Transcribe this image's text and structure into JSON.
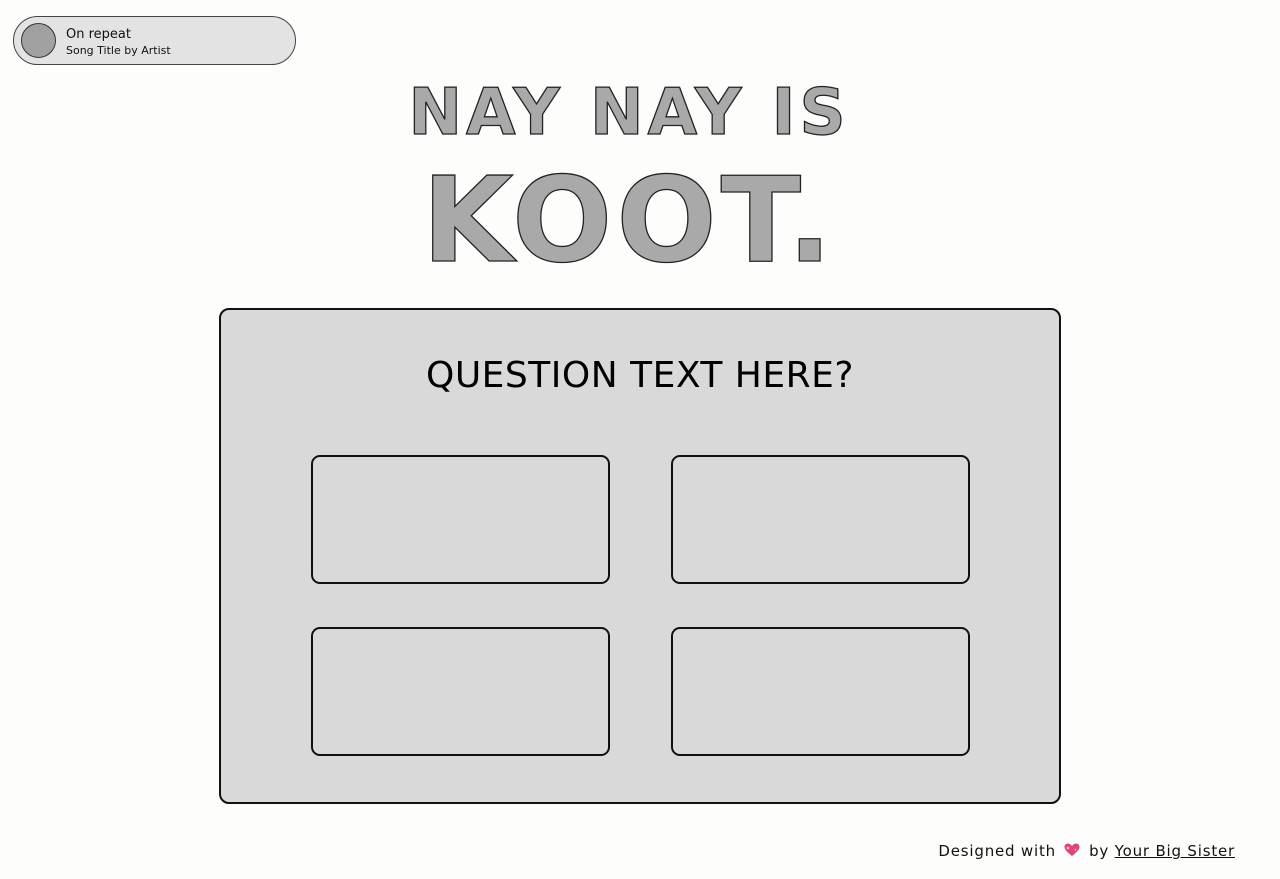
{
  "music": {
    "label": "On repeat",
    "song": "Song Title by Artist"
  },
  "title": {
    "line1": "NAY NAY IS",
    "line2": "KOOT."
  },
  "game": {
    "question": "QUESTION TEXT HERE?",
    "options": [
      "",
      "",
      "",
      ""
    ]
  },
  "footer": {
    "designed_with": "Designed with",
    "heart_icon": "sparkling-heart-icon",
    "by": "by",
    "author": "Your Big Sister"
  },
  "colors": {
    "background": "#fdfdfc",
    "card": "#d9d9d9",
    "title_fill": "#a9a9a9",
    "heart": "#e0447e"
  }
}
